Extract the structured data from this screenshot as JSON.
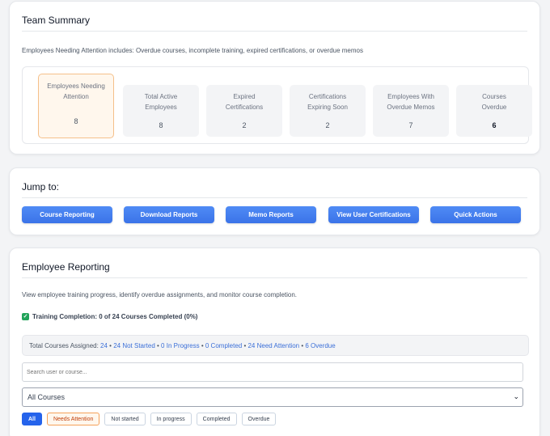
{
  "team_summary": {
    "title": "Team Summary",
    "description": "Employees Needing Attention includes: Overdue courses, incomplete training, expired certifications, or overdue memos",
    "stats": [
      {
        "label": "Employees Needing\nAttention",
        "value": "8"
      },
      {
        "label": "Total Active\nEmployees",
        "value": "8"
      },
      {
        "label": "Expired\nCertifications",
        "value": "2"
      },
      {
        "label": "Certifications\nExpiring Soon",
        "value": "2"
      },
      {
        "label": "Employees With\nOverdue Memos",
        "value": "7"
      },
      {
        "label": "Courses\nOverdue",
        "value": "6"
      }
    ]
  },
  "jump_to": {
    "title": "Jump to:",
    "buttons": [
      "Course Reporting",
      "Download Reports",
      "Memo Reports",
      "View User Certifications",
      "Quick Actions"
    ]
  },
  "employee_reporting": {
    "title": "Employee Reporting",
    "description": "View employee training progress, identify overdue assignments, and monitor course completion.",
    "completion_text": "Training Completion: 0 of 24 Courses Completed (0%)",
    "totals": {
      "prefix": "Total Courses Assigned: ",
      "assigned": "24",
      "not_started": "24 Not Started",
      "in_progress": "0 In Progress",
      "completed": "0 Completed",
      "needs_attention": "24 Need Attention",
      "overdue": "6 Overdue",
      "separator": " • "
    },
    "search_placeholder": "Search user or course...",
    "course_select_value": "All Courses",
    "filters": [
      "All",
      "Needs Attention",
      "Not started",
      "In progress",
      "Completed",
      "Overdue"
    ]
  },
  "colors": {
    "accent": "#3b73e8",
    "success": "#22a35a",
    "warning": "#f5a15a"
  }
}
